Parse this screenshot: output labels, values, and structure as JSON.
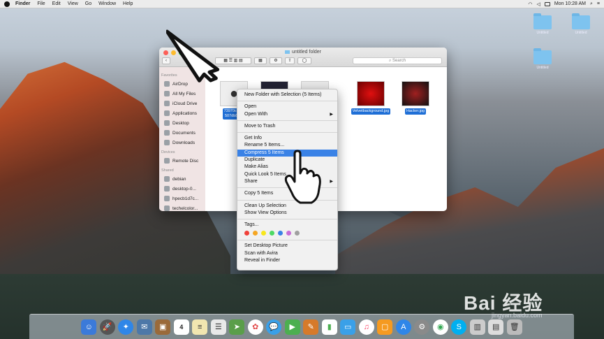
{
  "menubar": {
    "app": "Finder",
    "menus": [
      "File",
      "Edit",
      "View",
      "Go",
      "Window",
      "Help"
    ],
    "clock": "Mon 10:28 AM"
  },
  "desktop_icons": [
    {
      "label": "Untitled",
      "icon": "folder-icon"
    },
    {
      "label": "Untitled",
      "icon": "folder-icon"
    },
    {
      "label": "Untitled",
      "icon": "folder-icon"
    }
  ],
  "finder": {
    "title": "untitled folder",
    "search_placeholder": "Search",
    "sidebar": {
      "favorites_header": "Favorites",
      "favorites": [
        "AirDrop",
        "All My Files",
        "iCloud Drive",
        "Applications",
        "Desktop",
        "Documents",
        "Downloads"
      ],
      "devices_header": "Devices",
      "devices": [
        "Remote Disc"
      ],
      "shared_header": "Shared",
      "shared": [
        "debian",
        "desktop-0...",
        "hpecb1d7c...",
        "techelcolor..."
      ]
    },
    "files": [
      {
        "name": "73970c8b...\n507db8e...",
        "icon": "apple-icon"
      },
      {
        "name": "",
        "icon": "image-icon"
      },
      {
        "name": "",
        "icon": "image-icon"
      },
      {
        "name": "Velvetbackground.jpg",
        "icon": "image-icon"
      },
      {
        "name": "Hacker.jpg",
        "icon": "image-icon"
      }
    ]
  },
  "context_menu": {
    "items": [
      "New Folder with Selection (5 Items)",
      "Open",
      "Open With",
      "Move to Trash",
      "Get Info",
      "Rename 5 Items...",
      "Compress 5 Items",
      "Duplicate",
      "Make Alias",
      "Quick Look 5 Items",
      "Share",
      "Copy 5 Items",
      "Clean Up Selection",
      "Show View Options",
      "Tags...",
      "Set Desktop Picture",
      "Scan with Avira",
      "Reveal in Finder"
    ],
    "highlighted": "Compress 5 Items",
    "tag_colors": [
      "#f0413a",
      "#f5a623",
      "#f8e71c",
      "#4cd964",
      "#3a82e6",
      "#c86dd7",
      "#a0a0a0"
    ]
  },
  "watermark": {
    "logo": "Bai 经验",
    "url": "jingyan.baidu.com"
  },
  "dock_colors": [
    "#3b7ad9",
    "#666",
    "#2f86e8",
    "#4d78a8",
    "#9a6a3a",
    "#e24a4a",
    "#f2e6b0",
    "#e9e9e9",
    "#5a9e4a",
    "#f6c85a",
    "#3aa0e8",
    "#4caf50",
    "#d67a2a",
    "#3aa0e8",
    "#5a9e4a",
    "#e8e8e8",
    "#fb4a6a",
    "#f59a20",
    "#2f86e8",
    "#8a8a8a",
    "#34a853",
    "#2f86e8"
  ],
  "calendar_day": "4"
}
